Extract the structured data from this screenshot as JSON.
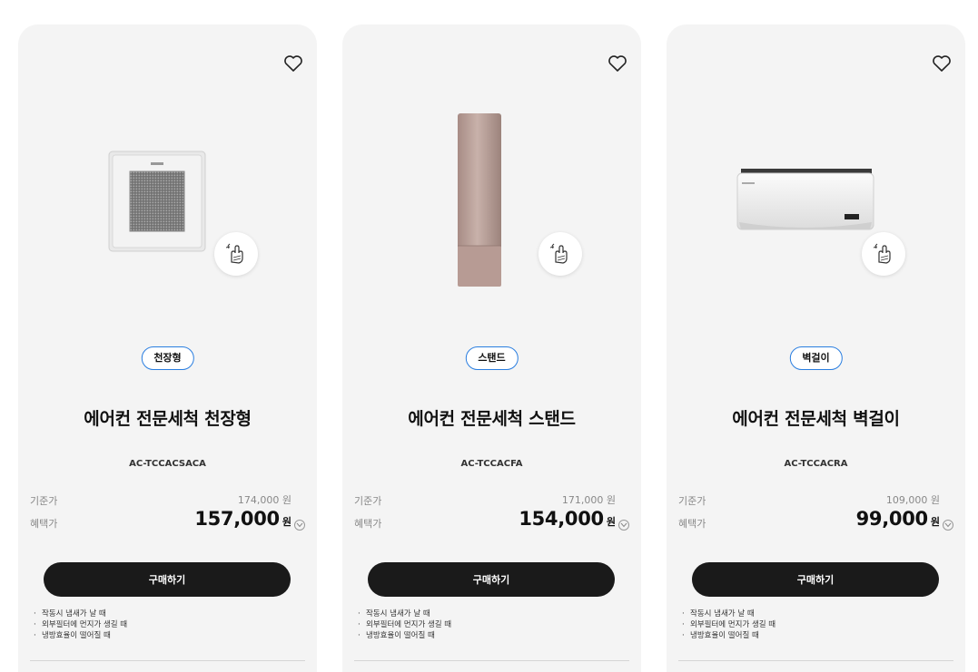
{
  "products": [
    {
      "category": "천장형",
      "title": "에어컨 전문세척 천장형",
      "model": "AC-TCCACSACA",
      "base_label": "기준가",
      "base_price": "174,000 원",
      "benefit_label": "혜택가",
      "benefit_price": "157,000",
      "benefit_unit": "원",
      "buy_label": "구매하기",
      "notes": [
        "작동시 냄새가 날 때",
        "외부필터에 먼지가 생길 때",
        "냉방효율이 떨어질 때"
      ]
    },
    {
      "category": "스탠드",
      "title": "에어컨 전문세척 스탠드",
      "model": "AC-TCCACFA",
      "base_label": "기준가",
      "base_price": "171,000 원",
      "benefit_label": "혜택가",
      "benefit_price": "154,000",
      "benefit_unit": "원",
      "buy_label": "구매하기",
      "notes": [
        "작동시 냄새가 날 때",
        "외부필터에 먼지가 생길 때",
        "냉방효율이 떨어질 때"
      ]
    },
    {
      "category": "벽걸이",
      "title": "에어컨 전문세척 벽걸이",
      "model": "AC-TCCACRA",
      "base_label": "기준가",
      "base_price": "109,000 원",
      "benefit_label": "혜택가",
      "benefit_price": "99,000",
      "benefit_unit": "원",
      "buy_label": "구매하기",
      "notes": [
        "작동시 냄새가 날 때",
        "외부필터에 먼지가 생길 때",
        "냉방효율이 떨어질 때"
      ]
    }
  ],
  "colors": {
    "card_bg": "#f4f4f4",
    "tag_border": "#2a7ee0",
    "button_bg": "#1a1a1a"
  },
  "icons": {
    "favorite": "heart-outline-icon",
    "badge": "cleaning-hand-sparkle-icon",
    "info": "chevron-down-circle-icon"
  }
}
